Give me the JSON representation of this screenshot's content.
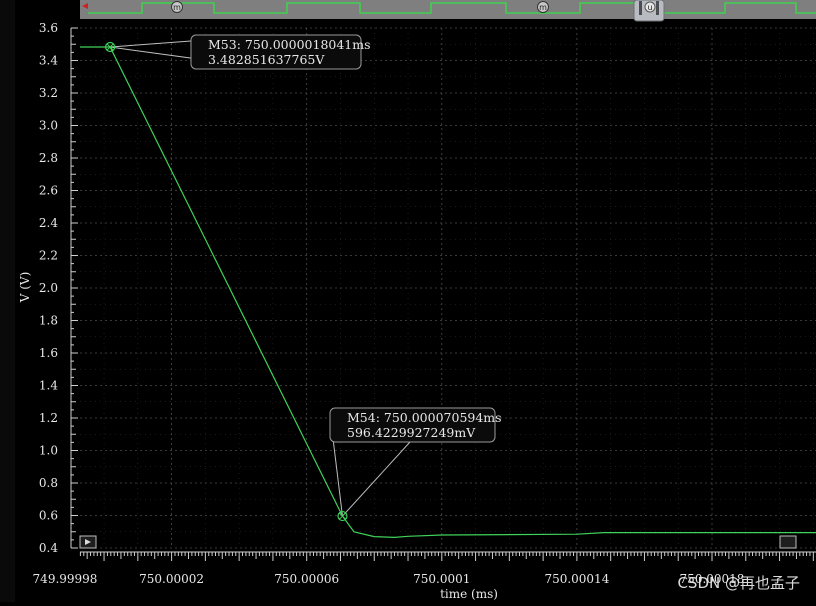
{
  "chart_data": {
    "type": "line",
    "xlabel": "time (ms)",
    "ylabel": "V (V)",
    "xlim": [
      749.99998,
      750.00018
    ],
    "ylim": [
      0.4,
      3.6
    ],
    "grid": true,
    "x_ticks": [
      "749.99998",
      "750.00002",
      "750.00006",
      "750.0001",
      "750.00014",
      "750.00018"
    ],
    "y_ticks": [
      "0.4",
      "0.6",
      "0.8",
      "1.0",
      "1.2",
      "1.4",
      "1.6",
      "1.8",
      "2.0",
      "2.2",
      "2.4",
      "2.6",
      "2.8",
      "3.0",
      "3.2",
      "3.4",
      "3.6"
    ],
    "series": [
      {
        "color": "#3fd25a",
        "x": [
          749.99998,
          750.0000018,
          750.000070594,
          750.000074,
          750.00008,
          750.000086,
          750.00009,
          750.0001,
          750.00014,
          750.000148,
          750.00018
        ],
        "y": [
          3.483,
          3.483,
          0.596,
          0.5,
          0.47,
          0.465,
          0.472,
          0.48,
          0.485,
          0.495,
          0.495
        ]
      }
    ],
    "markers": [
      {
        "label": "M53: 750.0000018041ms",
        "value": "3.482851637765V",
        "x": 750.0000018041,
        "y": 3.482851637765
      },
      {
        "label": "M54: 750.000070594ms",
        "value": "596.4229927249mV",
        "x": 750.000070594,
        "y": 0.5964229927249
      }
    ]
  },
  "timeline": {
    "marker_badge": "m",
    "cursor_badge": "u"
  },
  "watermark": "CSDN @再也孟子",
  "colors": {
    "background": "#000000",
    "trace": "#3fd25a",
    "grid": "#555555",
    "axis": "#cfcfcf",
    "text": "#e8e8e8"
  }
}
